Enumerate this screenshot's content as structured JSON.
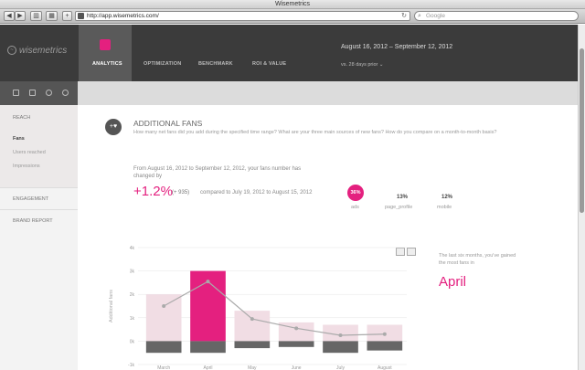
{
  "window": {
    "title": "Wisemetrics"
  },
  "browser": {
    "url": "http://app.wisemetrics.com/",
    "search_placeholder": "Google",
    "back_label": "◀",
    "forward_label": "▶"
  },
  "app": {
    "logo_text": "wisemetrics",
    "nav": [
      "ANALYTICS",
      "OPTIMIZATION",
      "BENCHMARK",
      "ROI & VALUE"
    ],
    "date_range": "August 16, 2012 – September 12, 2012",
    "compare_label": "vs. 28 days prior ⌄"
  },
  "sidebar": {
    "reach_header": "REACH",
    "reach_items": [
      "Fans",
      "Users reached",
      "Impressions"
    ],
    "engagement_header": "ENGAGEMENT",
    "brand_header": "BRAND REPORT"
  },
  "section": {
    "title": "ADDITIONAL FANS",
    "description": "How many net fans did you add during the specified time range? What are your three main sources of new fans? How do you compare on a month-to-month basis?",
    "stat_line": "From August 16, 2012 to September 12, 2012, your fans number has changed by",
    "big_pct": "+1.2%",
    "big_delta": "(+ 935)",
    "compare_text": "compared to July 19, 2012 to August 15, 2012"
  },
  "sources": [
    {
      "value": "36%",
      "label": "ads",
      "highlight": true
    },
    {
      "value": "13%",
      "label": "page_profile",
      "highlight": false
    },
    {
      "value": "12%",
      "label": "mobile",
      "highlight": false
    }
  ],
  "insight": {
    "text": "The last six months, you've gained the most fans in",
    "month": "April"
  },
  "colors": {
    "accent": "#e4207f",
    "header": "#3b3b3b",
    "bar_light": "#f1dde4",
    "bar_dark": "#666666"
  },
  "chart_data": {
    "type": "bar",
    "categories": [
      "March",
      "April",
      "May",
      "June",
      "July",
      "August"
    ],
    "series": [
      {
        "values": [
          2000,
          3000,
          1300,
          800,
          700,
          700
        ]
      },
      {
        "values": [
          -500,
          -500,
          -300,
          -250,
          -500,
          -400
        ]
      },
      {
        "values": [
          1500,
          2550,
          950,
          550,
          250,
          300
        ]
      }
    ],
    "ylabel": "Additional fans",
    "ylim": [
      -1000,
      4000
    ],
    "yticks": [
      "4k",
      "3k",
      "2k",
      "1k",
      "0k",
      "-1k"
    ],
    "highlight_index": 1
  }
}
